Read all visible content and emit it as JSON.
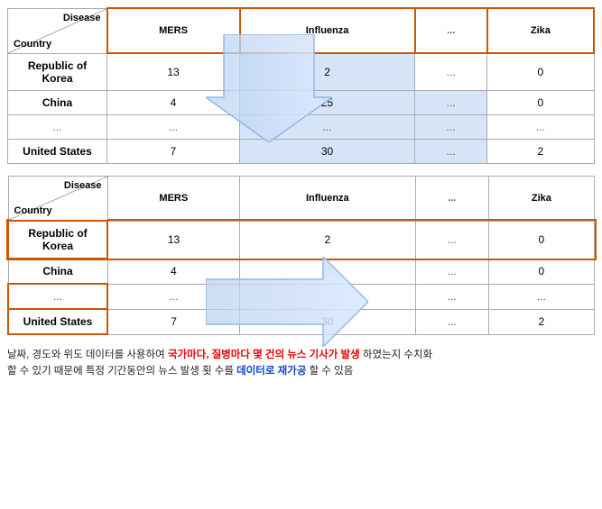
{
  "tables": [
    {
      "id": "top-table",
      "header": {
        "disease_label": "Disease",
        "country_label": "Country",
        "columns": [
          "MERS",
          "Influenza",
          "...",
          "Zika"
        ]
      },
      "rows": [
        {
          "country": "Republic of Korea",
          "values": [
            "13",
            "2",
            "...",
            "0"
          ]
        },
        {
          "country": "China",
          "values": [
            "4",
            "25",
            "...",
            "0"
          ]
        },
        {
          "country": "...",
          "values": [
            "...",
            "...",
            "...",
            "..."
          ]
        },
        {
          "country": "United States",
          "values": [
            "7",
            "30",
            "...",
            "2"
          ]
        }
      ],
      "arrow": "down",
      "highlight_col": 2
    },
    {
      "id": "bottom-table",
      "header": {
        "disease_label": "Disease",
        "country_label": "Country",
        "columns": [
          "MERS",
          "Influenza",
          "...",
          "Zika"
        ]
      },
      "rows": [
        {
          "country": "Republic of Korea",
          "values": [
            "13",
            "2",
            "...",
            "0"
          ],
          "highlight_row": true
        },
        {
          "country": "China",
          "values": [
            "4",
            "25",
            "...",
            "0"
          ]
        },
        {
          "country": "...",
          "values": [
            "...",
            "...",
            "...",
            "..."
          ],
          "highlight_row": true
        },
        {
          "country": "United States",
          "values": [
            "7",
            "30",
            "...",
            "2"
          ],
          "highlight_row": true
        }
      ],
      "arrow": "right",
      "highlight_col": 2
    }
  ],
  "caption": {
    "text_before": "날짜, 경도와 위도 데이터를 사용하여 ",
    "red_text": "국가마다, 질병마다 몇 건의 뉴스 기사가 발생",
    "text_middle": " 하였는지 수치화\n할 수 있기 때문에 특정 기간동안의 뉴스 발생 횟 수를 ",
    "blue_text": "데이터로 재가공",
    "text_end": " 할 수 있음"
  }
}
